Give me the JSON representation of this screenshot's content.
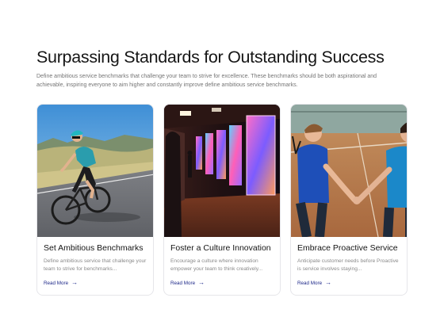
{
  "header": {
    "title": "Surpassing Standards for Outstanding Success",
    "description": "Define ambitious service benchmarks that challenge your team to strive for excellence. These benchmarks should be both aspirational and achievable, inspiring everyone to aim higher and constantly improve define ambitious service benchmarks."
  },
  "cards": [
    {
      "title": "Set Ambitious Benchmarks",
      "description": "Define ambitious service that challenge your team to strive for benchmarks...",
      "link_label": "Read More",
      "icon": "arrow-right-icon"
    },
    {
      "title": "Foster a Culture Innovation",
      "description": "Encourage a culture where innovation empower your team to think creatively...",
      "link_label": "Read More",
      "icon": "arrow-right-icon"
    },
    {
      "title": "Embrace Proactive Service",
      "description": "Anticipate customer needs before Proactive is service involves staying...",
      "link_label": "Read More",
      "icon": "arrow-right-icon"
    }
  ],
  "colors": {
    "link": "#1f2a8a",
    "heading": "#161616",
    "body_text": "#757575",
    "card_border": "#e6e6ea"
  }
}
